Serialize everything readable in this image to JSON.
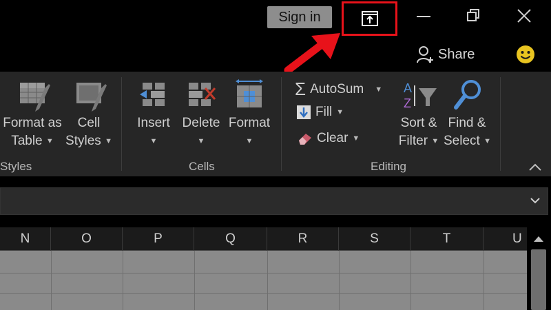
{
  "titlebar": {
    "signin_label": "Sign in",
    "share_label": "Share"
  },
  "icons": {
    "ribbon_display": "ribbon-display-options-icon",
    "minimize": "minimize-icon",
    "restore": "restore-icon",
    "close": "close-icon",
    "share": "share-person-icon",
    "feedback": "smiley-icon"
  },
  "ribbon": {
    "styles": {
      "label": "Styles",
      "format_as_table": [
        "Format as",
        "Table"
      ],
      "cell_styles": [
        "Cell",
        "Styles"
      ]
    },
    "cells": {
      "label": "Cells",
      "insert": "Insert",
      "delete": "Delete",
      "format": "Format"
    },
    "editing": {
      "label": "Editing",
      "autosum": "AutoSum",
      "fill": "Fill",
      "clear": "Clear",
      "sort_filter": [
        "Sort &",
        "Filter"
      ],
      "find_select": [
        "Find &",
        "Select"
      ]
    }
  },
  "grid": {
    "columns": [
      "N",
      "O",
      "P",
      "Q",
      "R",
      "S",
      "T",
      "U"
    ]
  },
  "colors": {
    "highlight": "#e8121a",
    "background": "#000000",
    "ribbon": "#262626",
    "cells": "#8a8a8a"
  }
}
